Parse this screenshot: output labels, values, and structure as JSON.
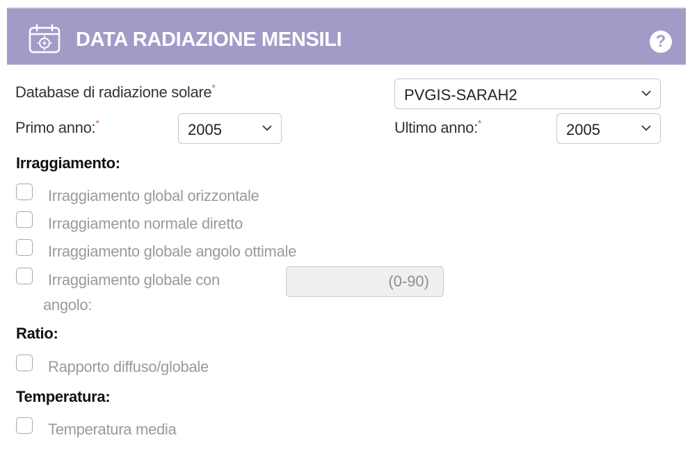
{
  "header": {
    "title": "DATA RADIAZIONE MENSILI",
    "help_glyph": "?",
    "background": "#a09cc7",
    "icon": "calendar-sun-icon"
  },
  "database": {
    "label": "Database di radiazione solare",
    "required_mark": "*",
    "value": "PVGIS-SARAH2"
  },
  "primo_anno": {
    "label": "Primo anno:",
    "required_mark": "*",
    "value": "2005"
  },
  "ultimo_anno": {
    "label": "Ultimo anno:",
    "required_mark": "*",
    "value": "2005"
  },
  "irraggiamento": {
    "title": "Irraggiamento:",
    "options": [
      "Irraggiamento global orizzontale",
      "Irraggiamento normale diretto",
      "Irraggiamento globale angolo ottimale"
    ],
    "angle_option": {
      "label_line1": "Irraggiamento globale con",
      "label_line2": "angolo:",
      "placeholder": "(0-90)"
    }
  },
  "ratio": {
    "title": "Ratio:",
    "option": "Rapporto diffuso/globale"
  },
  "temperatura": {
    "title": "Temperatura:",
    "option": "Temperatura media"
  },
  "colors": {
    "required": "#e05a3c",
    "muted_text": "#9a9a9a"
  }
}
